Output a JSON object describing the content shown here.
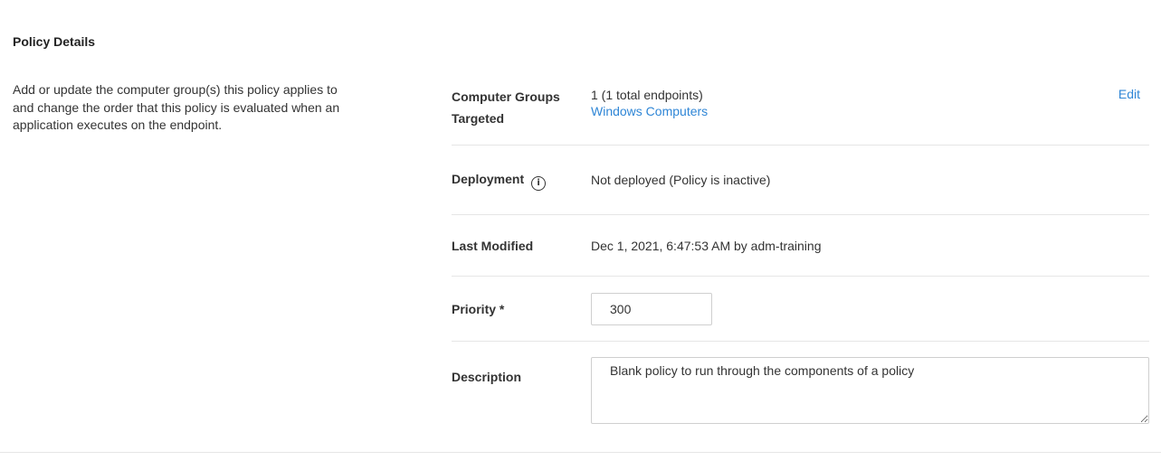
{
  "section": {
    "title": "Policy Details",
    "description": "Add or update the computer group(s) this policy applies to and change the order that this policy is evaluated when an application executes on the endpoint."
  },
  "details": {
    "groups": {
      "label": "Computer Groups Targeted",
      "count_text": "1 (1 total endpoints)",
      "group_link": "Windows Computers",
      "edit_label": "Edit"
    },
    "deployment": {
      "label": "Deployment",
      "icon": "info-icon",
      "value": "Not deployed (Policy is inactive)"
    },
    "last_modified": {
      "label": "Last Modified",
      "value": "Dec 1, 2021, 6:47:53 AM by adm-training"
    },
    "priority": {
      "label": "Priority *",
      "value": "300"
    },
    "description": {
      "label": "Description",
      "value": "Blank policy to run through the components of a policy"
    }
  },
  "colors": {
    "link": "#2f86d6",
    "divider": "#e6e6e6",
    "text": "#333333"
  }
}
